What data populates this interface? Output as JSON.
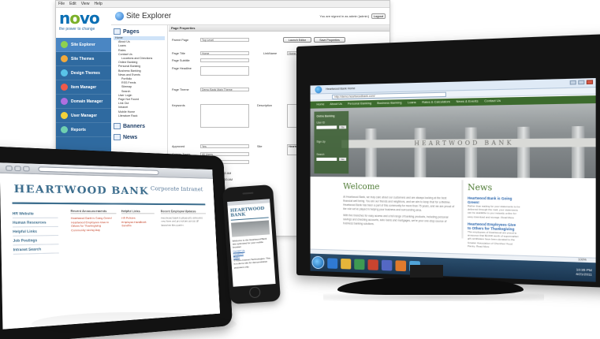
{
  "cms": {
    "menu": [
      "File",
      "Edit",
      "View",
      "Help"
    ],
    "logo": {
      "n": "n",
      "o1": "o",
      "v": "v",
      "o2": "o"
    },
    "tagline": "the power to change",
    "title": "Site Explorer",
    "signed_in": "You are signed in as admin [admin]",
    "logout": "Logout",
    "sidebar": [
      {
        "label": "Site Explorer",
        "color": "#8fd14f"
      },
      {
        "label": "Site Themes",
        "color": "#f2a93b"
      },
      {
        "label": "Design Themes",
        "color": "#59c4e8"
      },
      {
        "label": "Item Manager",
        "color": "#f05a4a"
      },
      {
        "label": "Domain Manager",
        "color": "#b06fe0"
      },
      {
        "label": "User Manager",
        "color": "#f2d23b"
      },
      {
        "label": "Reports",
        "color": "#6fd0b0"
      }
    ],
    "tree_heading": "Pages",
    "tree": [
      "Home",
      "About Us",
      "Loans",
      "Rates",
      "Contact Us",
      "Locations and Directions",
      "Online Banking",
      "Personal Banking",
      "Business Banking",
      "News and Events",
      "Portfolio",
      "RSS Feeds",
      "Sitemap",
      "Search",
      "User Login",
      "Page Not Found",
      "Link Out",
      "Intranet",
      "Mobile Home",
      "Literature Rack"
    ],
    "banners": "Banners",
    "news": "News",
    "props": {
      "heading": "Page Properties",
      "parent_page_label": "Parent Page",
      "parent_page_value": "Top Level",
      "launch_editor": "Launch Editor",
      "save_properties": "Save Properties",
      "page_title_label": "Page Title",
      "page_title_value": "Home",
      "link_name_label": "LinkName",
      "link_name_value": "Home Link",
      "page_subtitle_label": "Page Subtitle",
      "page_headline_label": "Page Headline",
      "page_theme_label": "Page Theme",
      "page_theme_value": "Demo Bank Main Theme",
      "keywords_label": "Keywords",
      "description_label": "Description",
      "approved_label": "Approved",
      "approved_value": "Yes",
      "site_label": "Site",
      "site_value": "Heartwood",
      "access_types_label": "Access Types",
      "access_types_value": "All Users",
      "page_types_label": "Page Types",
      "page_types_value": "Start Page",
      "date1": "6/15/2010 10:43:00 AM",
      "date2": "11/19/2009 12:44:00 AM"
    }
  },
  "monitor": {
    "tab_title": "Heartwood Bank Home",
    "address": "http://demo.heartwoodbank.com/",
    "nav": [
      "Home",
      "About Us",
      "Personal Banking",
      "Business Banking",
      "Loans",
      "Rates & Calculators",
      "News & Events",
      "Contact Us"
    ],
    "login": {
      "title": "Online Banking",
      "user": "User ID",
      "go": "Go",
      "signup": "Sign Up",
      "search": "Search"
    },
    "hero_text": "HEARTWOOD BANK",
    "welcome_heading": "Welcome",
    "welcome_p1": "At Heartwood Bank, we truly care about our customers and are always looking at the best financial well being. You are our friends and neighbors, and we aim to keep that for a lifetime. Heartwood Bank has been a part of this community for more than 75 years, and we are proud of the role we've played in helping your business and surrounding area.",
    "welcome_p2": "With five branches for easy access and a full range of banking products, including personal savings and checking accounts, auto loans and mortgages, we're your one-stop source of business banking solutions.",
    "news_heading": "News",
    "news": [
      {
        "title": "Heartwood Bank is Going Green!",
        "desc": "Rather than waiting for your statements to be delivered through the mail, your statements can be available to you instantly online for easy download and storage. Read More"
      },
      {
        "title": "Heartwood Employees Give to Others for Thanksgiving",
        "desc": "The employees of Heartwood are proud to announce that $3,000 worth of supermarket gift certificates have been donated to the Greater Association of Churches' Food Pantry. Read More"
      }
    ],
    "zoom": "100%",
    "clock_time": "10:35 PM",
    "clock_date": "4/21/2011"
  },
  "tablet": {
    "logo": "HEARTWOOD BANK",
    "corporate": "Corporate Intranet",
    "left_links": [
      "HR Website",
      "Human Resources",
      "Helpful Links",
      "Job Postings",
      "Intranet Search"
    ],
    "col1_heading": "Recent Announcements",
    "col1_links": [
      "Heartwood Bank is Going Green!",
      "Heartwood Employees Give to Others for Thanksgiving",
      "Community Giving Day"
    ],
    "col2_heading": "Helpful Links",
    "col2_links": [
      "HR Policies",
      "Employee Handbook",
      "Benefits"
    ],
    "col3_heading": "Recent Employee Updates",
    "col3_text": "Heartwood Bank is pleased to announce new hires and promotions across all branches this quarter."
  },
  "phone": {
    "logo": "HEARTWOOD BANK",
    "p1": "Welcome to the Heartwood Bank site optimized for your mobile browser.",
    "links": [
      "Contact Us",
      "Locations",
      "Rates"
    ],
    "p2": "© Novo Internet Technologies. This is a demo site for demonstration purposes only."
  }
}
